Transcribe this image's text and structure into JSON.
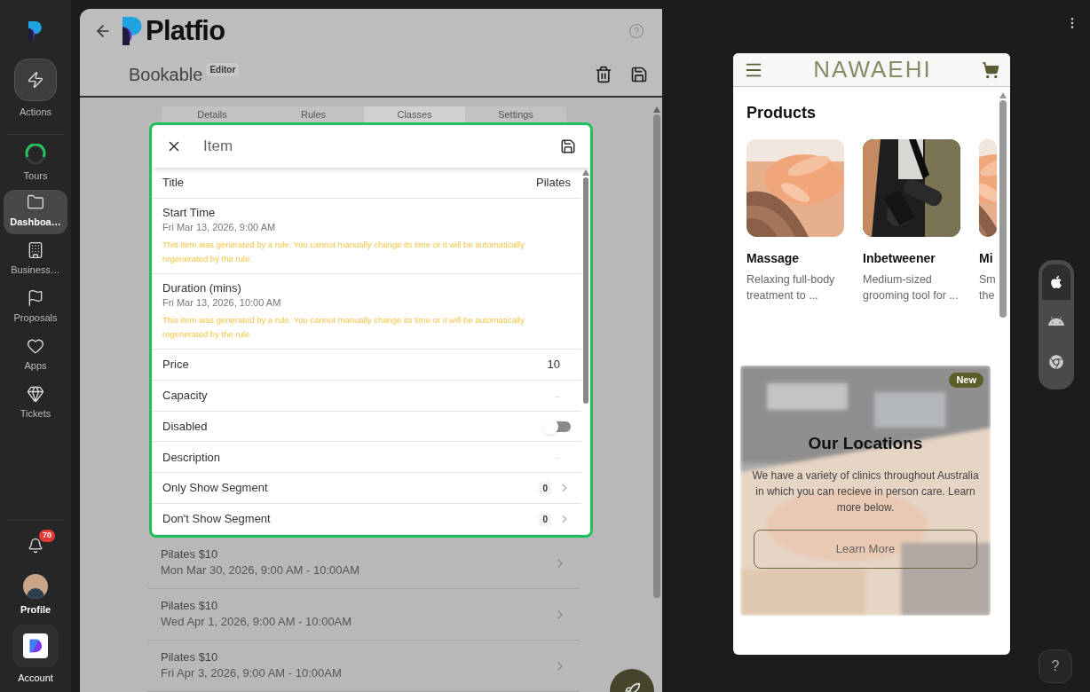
{
  "sidebar": {
    "actions": {
      "label": "Actions"
    },
    "items": [
      {
        "kind": "tours",
        "label": "Tours",
        "selected": false
      },
      {
        "kind": "folder",
        "label": "Dashboa…",
        "selected": true
      },
      {
        "kind": "building",
        "label": "Business…",
        "selected": false
      },
      {
        "kind": "flag",
        "label": "Proposals",
        "selected": false
      },
      {
        "kind": "heart",
        "label": "Apps",
        "selected": false
      },
      {
        "kind": "gem",
        "label": "Tickets",
        "selected": false
      }
    ],
    "notifications": {
      "count": "70"
    },
    "profile": {
      "label": "Profile"
    },
    "account": {
      "label": "Account"
    }
  },
  "editor": {
    "logo": "Platfio",
    "title": "Bookable",
    "badge": "Editor",
    "tabs": [
      {
        "label": "Details",
        "selected": false
      },
      {
        "label": "Rules",
        "selected": false
      },
      {
        "label": "Classes",
        "selected": true
      },
      {
        "label": "Settings",
        "selected": false
      }
    ],
    "modal": {
      "title": "Item",
      "rows": [
        {
          "kind": "value",
          "label": "Title",
          "value": "Pilates"
        },
        {
          "kind": "generated",
          "label": "Start Time",
          "time": "Fri Mar 13, 2026, 9:00 AM",
          "note": "This item was generated by a rule. You cannot manually change its time or it will be automatically regenerated by the rule."
        },
        {
          "kind": "generated",
          "label": "Duration (mins)",
          "time": "Fri Mar 13, 2026, 10:00 AM",
          "note": "This item was generated by a rule. You cannot manually change its time or it will be automatically regenerated by the rule."
        },
        {
          "kind": "value",
          "label": "Price",
          "value": "10"
        },
        {
          "kind": "empty",
          "label": "Capacity",
          "placeholder": "..."
        },
        {
          "kind": "toggle",
          "label": "Disabled",
          "on": false
        },
        {
          "kind": "empty",
          "label": "Description",
          "placeholder": ".."
        },
        {
          "kind": "nav",
          "label": "Only Show Segment",
          "count": "0"
        },
        {
          "kind": "nav",
          "label": "Don't Show Segment",
          "count": "0"
        }
      ]
    },
    "classes": [
      {
        "title": "Pilates $10",
        "time": "Mon Mar 30, 2026, 9:00 AM - 10:00AM"
      },
      {
        "title": "Pilates $10",
        "time": "Wed Apr 1, 2026, 9:00 AM - 10:00AM"
      },
      {
        "title": "Pilates $10",
        "time": "Fri Apr 3, 2026, 9:00 AM - 10:00AM"
      }
    ]
  },
  "preview": {
    "logo": "NAWAEHI",
    "products_title": "Products",
    "products": [
      {
        "kind": "massage",
        "name": "Massage",
        "description": "Relaxing full-body treatment to ..."
      },
      {
        "kind": "tool",
        "name": "Inbetweener",
        "description": "Medium-sized grooming tool for ..."
      },
      {
        "kind": "massage",
        "name": "Mi",
        "description": "Sm the"
      }
    ],
    "banner": {
      "badge": "New",
      "title": "Our Locations",
      "text": "We have a variety of clinics throughout Australia in which you can recieve in person care. Learn more below.",
      "button": "Learn More"
    }
  },
  "help": {
    "label": "?"
  },
  "platforms": [
    {
      "kind": "apple",
      "selected": true
    },
    {
      "kind": "android",
      "selected": false
    },
    {
      "kind": "chrome",
      "selected": false
    }
  ]
}
